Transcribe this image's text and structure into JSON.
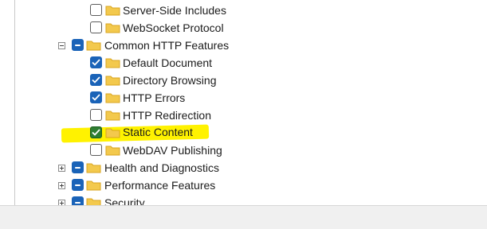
{
  "tree": {
    "items": [
      {
        "label": "Server-Side Includes",
        "state": "unchecked"
      },
      {
        "label": "WebSocket Protocol",
        "state": "unchecked"
      },
      {
        "label": "Common HTTP Features",
        "state": "partial",
        "expander": "collapse"
      },
      {
        "label": "Default Document",
        "state": "checked"
      },
      {
        "label": "Directory Browsing",
        "state": "checked"
      },
      {
        "label": "HTTP Errors",
        "state": "checked"
      },
      {
        "label": "HTTP Redirection",
        "state": "unchecked"
      },
      {
        "label": "Static Content",
        "state": "checked",
        "highlighted": true
      },
      {
        "label": "WebDAV Publishing",
        "state": "unchecked"
      },
      {
        "label": "Health and Diagnostics",
        "state": "partial",
        "expander": "expand"
      },
      {
        "label": "Performance Features",
        "state": "partial",
        "expander": "expand"
      },
      {
        "label": "Security",
        "state": "partial",
        "expander": "expand"
      }
    ]
  },
  "colors": {
    "checkbox_checked": "#1a63b8",
    "highlight": "#fff200",
    "folder": "#f3c94d"
  },
  "icons": {
    "folder": "folder-icon",
    "check": "checkmark-icon",
    "expand": "plus-expander-icon",
    "collapse": "minus-expander-icon"
  }
}
